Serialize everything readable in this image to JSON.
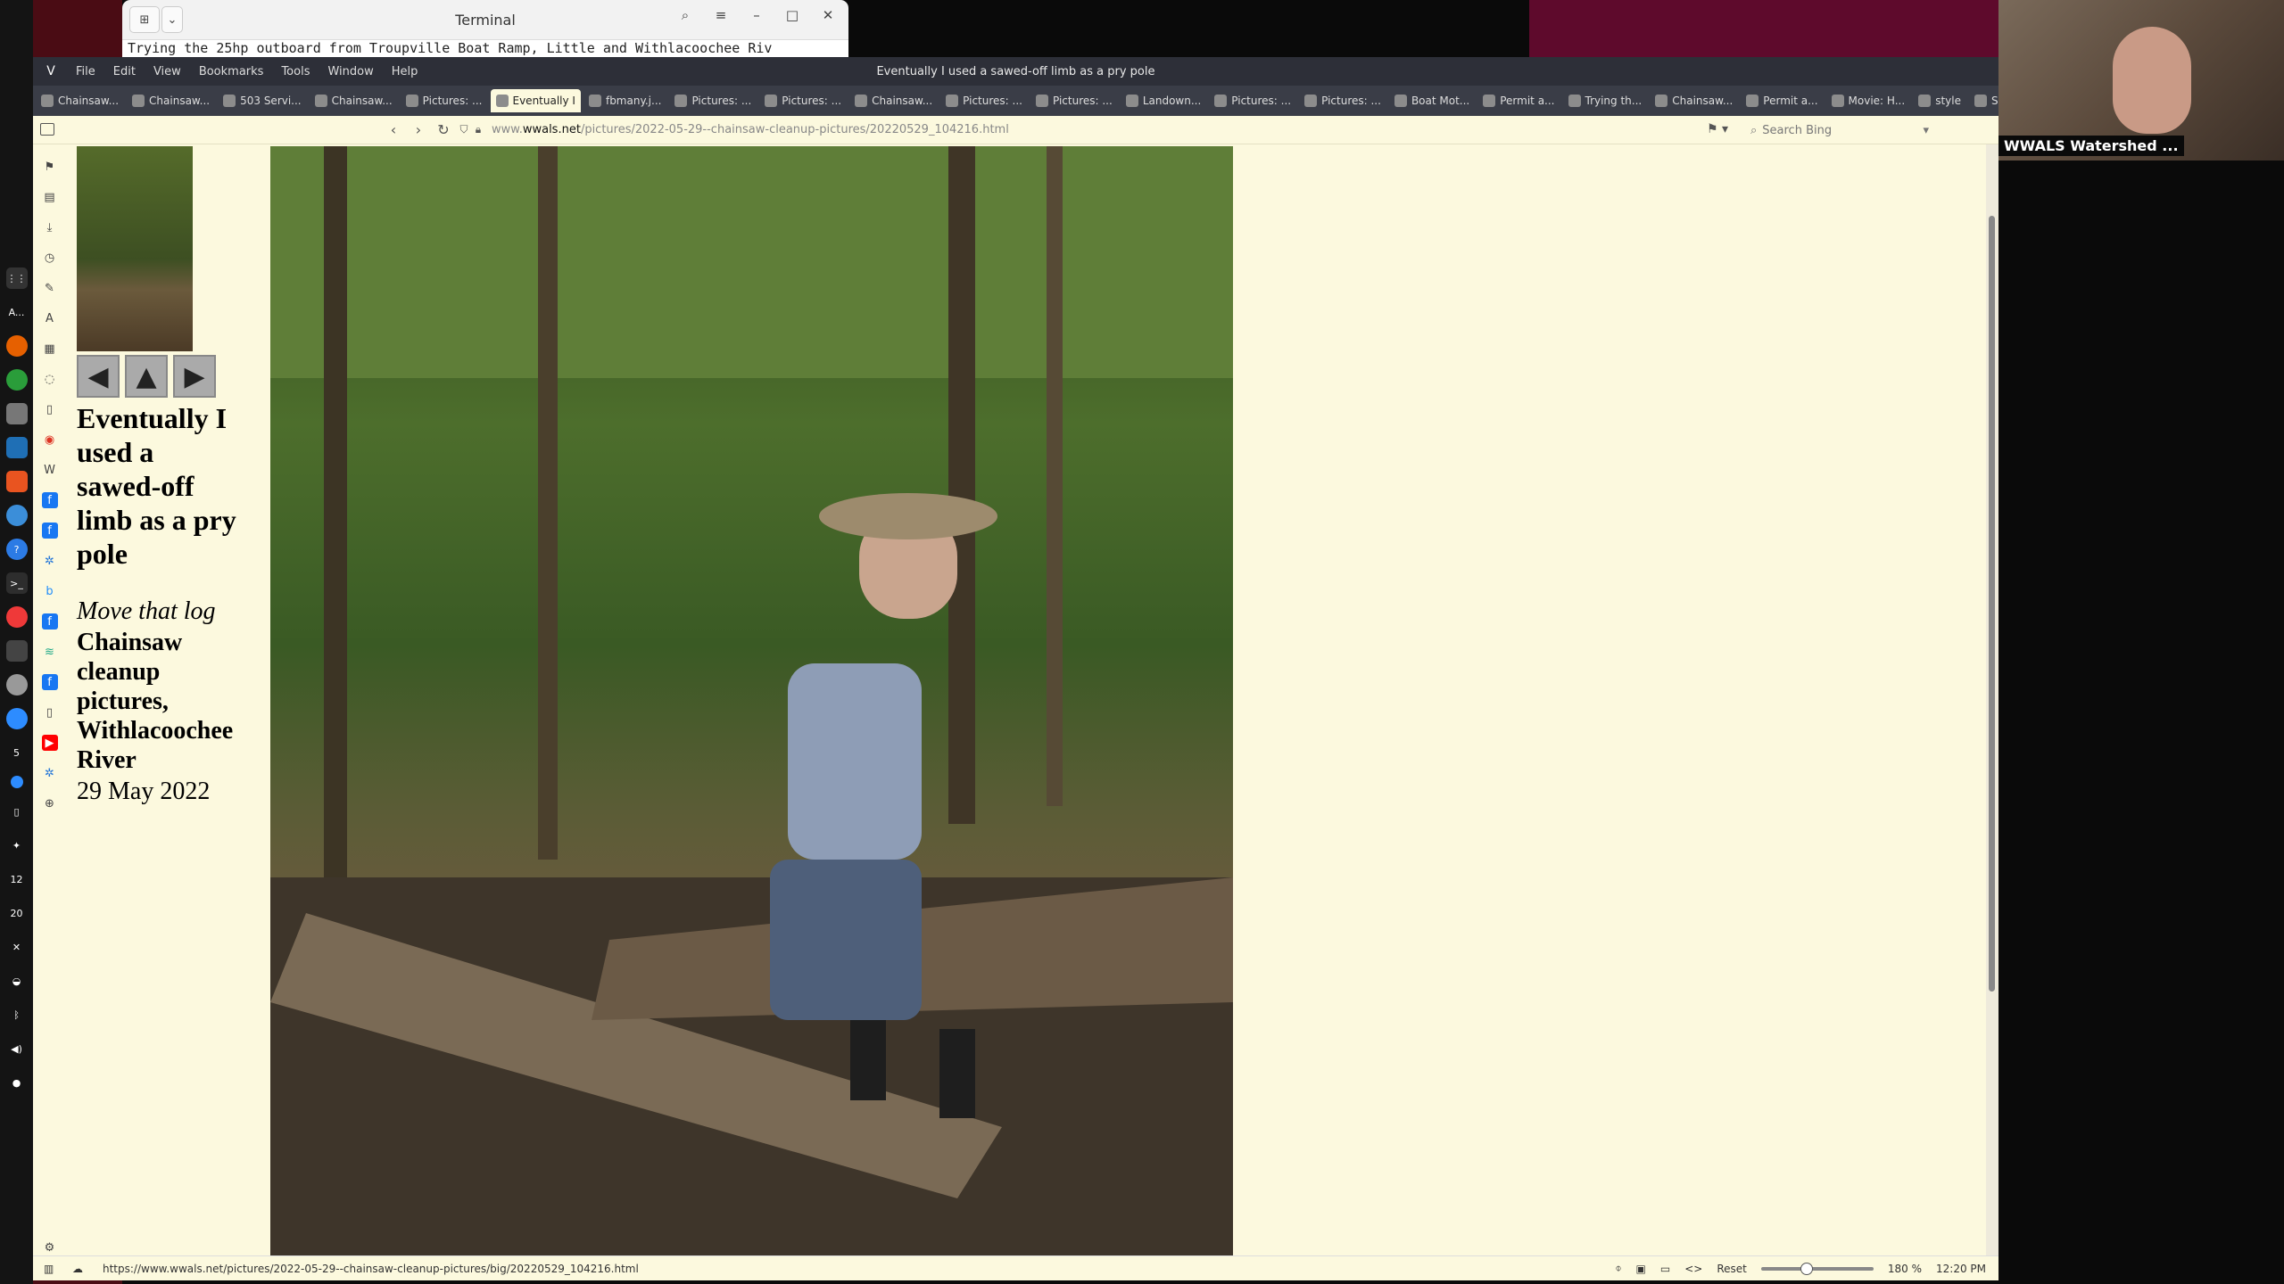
{
  "terminal": {
    "title": "Terminal",
    "line": "Trying the 25hp outboard from Troupville Boat Ramp, Little and Withlacoochee Riv"
  },
  "browser": {
    "window_title": "Eventually I used a sawed-off limb as a pry pole",
    "menu": [
      "File",
      "Edit",
      "View",
      "Bookmarks",
      "Tools",
      "Window",
      "Help"
    ],
    "tabs": [
      {
        "label": "Chainsaw...",
        "active": false
      },
      {
        "label": "Chainsaw...",
        "active": false
      },
      {
        "label": "503 Servi...",
        "active": false
      },
      {
        "label": "Chainsaw...",
        "active": false
      },
      {
        "label": "Pictures: ...",
        "active": false
      },
      {
        "label": "Eventually I",
        "active": true
      },
      {
        "label": "fbmany.j...",
        "active": false
      },
      {
        "label": "Pictures: ...",
        "active": false
      },
      {
        "label": "Pictures: ...",
        "active": false
      },
      {
        "label": "Chainsaw...",
        "active": false
      },
      {
        "label": "Pictures: ...",
        "active": false
      },
      {
        "label": "Pictures: ...",
        "active": false
      },
      {
        "label": "Landown...",
        "active": false
      },
      {
        "label": "Pictures: ...",
        "active": false
      },
      {
        "label": "Pictures: ...",
        "active": false
      },
      {
        "label": "Boat Mot...",
        "active": false
      },
      {
        "label": "Permit a...",
        "active": false
      },
      {
        "label": "Trying th...",
        "active": false
      },
      {
        "label": "Chainsaw...",
        "active": false
      },
      {
        "label": "Permit a...",
        "active": false
      },
      {
        "label": "Movie: H...",
        "active": false
      },
      {
        "label": "style",
        "active": false
      },
      {
        "label": "Suwanne...",
        "active": false
      }
    ],
    "url_prefix": "www.",
    "url_domain": "wwals.net",
    "url_path": "/pictures/2022-05-29--chainsaw-cleanup-pictures/20220529_104216.html",
    "search_placeholder": "Search Bing",
    "status_link": "https://www.wwals.net/pictures/2022-05-29--chainsaw-cleanup-pictures/big/20220529_104216.html",
    "zoom_reset": "Reset",
    "zoom_level": "180 %",
    "clock": "12:20 PM"
  },
  "page": {
    "title": "Eventually I used a sawed-off limb as a pry pole",
    "caption": "Move that log",
    "gallery": "Chainsaw cleanup pictures, Withlacoochee River",
    "date": "29 May 2022"
  },
  "video": {
    "name": "WWALS Watershed ..."
  },
  "dock": {
    "labels": [
      "A...",
      "5",
      "12",
      "20"
    ]
  }
}
